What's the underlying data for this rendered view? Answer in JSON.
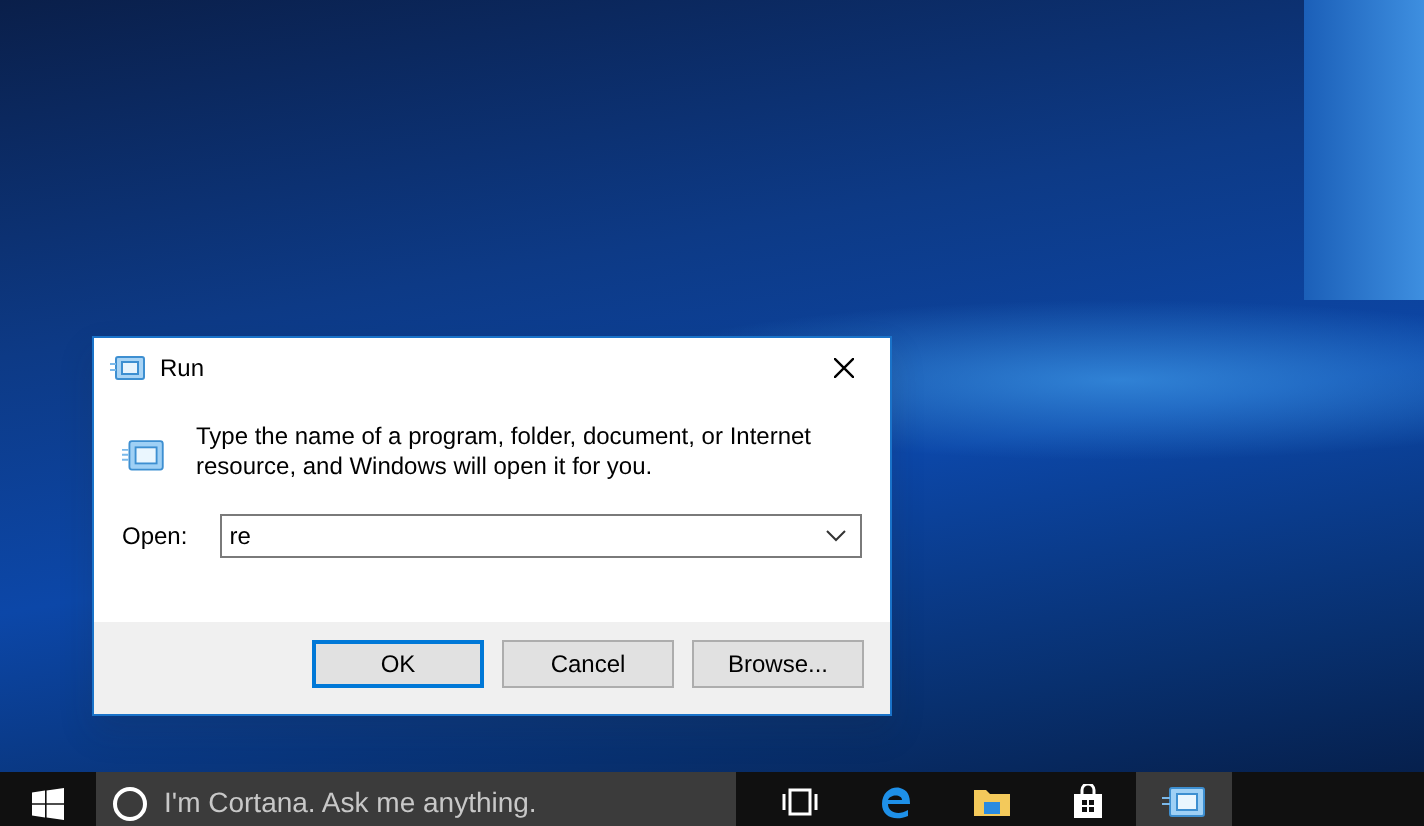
{
  "window": {
    "title": "Run"
  },
  "dialog": {
    "message": "Type the name of a program, folder, document, or Internet resource, and Windows will open it for you.",
    "open_label": "Open:",
    "open_value": "re",
    "buttons": [
      {
        "label": "OK",
        "default": true
      },
      {
        "label": "Cancel",
        "default": false
      },
      {
        "label": "Browse...",
        "default": false
      }
    ]
  },
  "taskbar": {
    "search_placeholder": "I'm Cortana. Ask me anything.",
    "apps": [
      {
        "kind": "taskview",
        "active": false
      },
      {
        "kind": "edge",
        "active": false
      },
      {
        "kind": "folder",
        "active": false
      },
      {
        "kind": "store",
        "active": false
      },
      {
        "kind": "run",
        "active": true
      }
    ]
  }
}
